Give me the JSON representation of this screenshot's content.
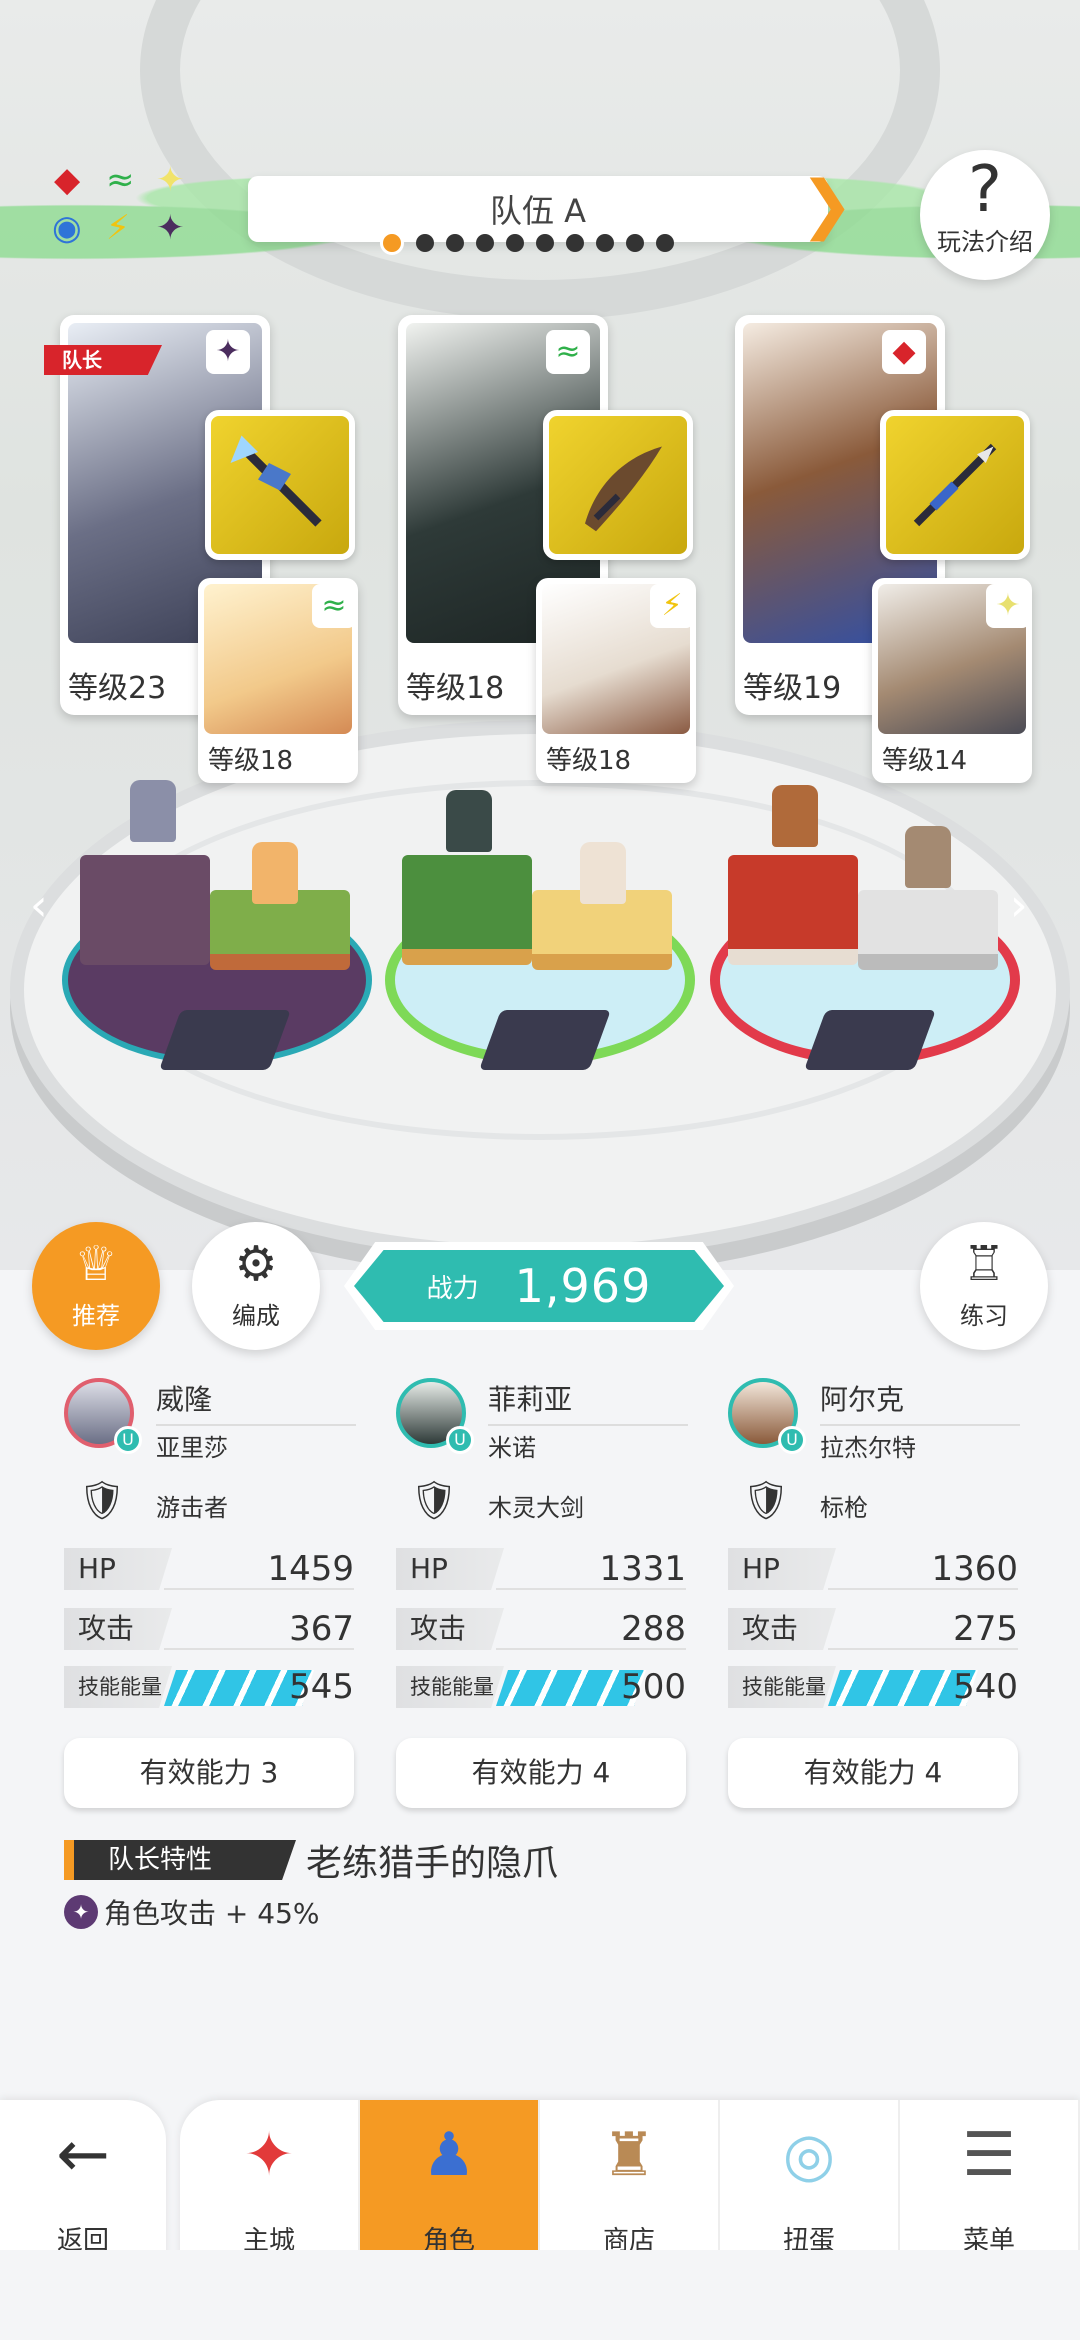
{
  "team": {
    "name": "队伍 A",
    "page_dots": 10,
    "active_dot": 0
  },
  "help": {
    "label": "玩法介绍"
  },
  "captain_tag": "队长",
  "power": {
    "label": "战力",
    "value": "1,969"
  },
  "controls": {
    "recommend": "推荐",
    "formation": "编成",
    "practice": "练习"
  },
  "members": [
    {
      "name": "威隆",
      "character": "亚里莎",
      "weapon": "游击者",
      "main_level": "等级23",
      "sub_level": "等级18",
      "hp_label": "HP",
      "hp": "1459",
      "atk_label": "攻击",
      "atk": "367",
      "skill_label": "技能能量",
      "skill": "545",
      "ability": "有效能力 3",
      "main_color": "#6b6f86",
      "sub_color": "#f2c98a",
      "elem_main": "✦",
      "elem_sub": "≈"
    },
    {
      "name": "菲莉亚",
      "character": "米诺",
      "weapon": "木灵大剑",
      "main_level": "等级18",
      "sub_level": "等级18",
      "hp_label": "HP",
      "hp": "1331",
      "atk_label": "攻击",
      "atk": "288",
      "skill_label": "技能能量",
      "skill": "500",
      "ability": "有效能力 4",
      "main_color": "#2e3a38",
      "sub_color": "#e6dcd0",
      "elem_main": "≈",
      "elem_sub": "⚡"
    },
    {
      "name": "阿尔克",
      "character": "拉杰尔特",
      "weapon": "标枪",
      "main_level": "等级19",
      "sub_level": "等级14",
      "hp_label": "HP",
      "hp": "1360",
      "atk_label": "攻击",
      "atk": "275",
      "skill_label": "技能能量",
      "skill": "540",
      "ability": "有效能力 4",
      "main_color": "#8a5a3a",
      "sub_color": "#a48a72",
      "elem_main": "◆",
      "elem_sub": "✦"
    }
  ],
  "leader": {
    "tag": "队长特性",
    "skill_name": "老练猎手的隐爪",
    "effect": "角色攻击 + 45%"
  },
  "nav": {
    "back": "返回",
    "home": "主城",
    "character": "角色",
    "shop": "商店",
    "gacha": "扭蛋",
    "menu": "菜单"
  },
  "colors": {
    "accent": "#f59a23",
    "teal": "#2fbcb0",
    "energy": "#30c5e6"
  }
}
